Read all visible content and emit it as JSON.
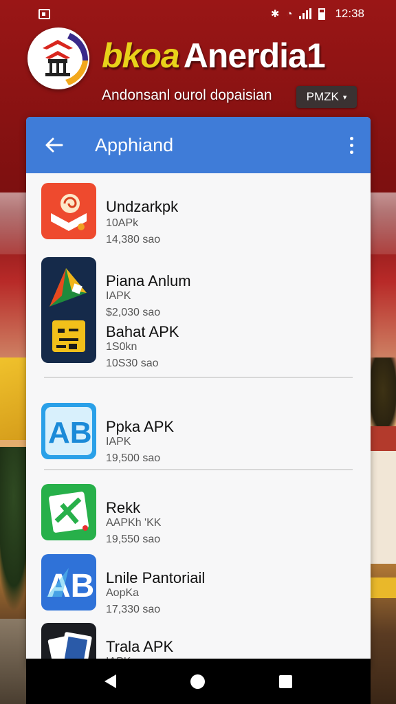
{
  "status_bar": {
    "time": "12:38"
  },
  "banner": {
    "title_part1": "bkoa",
    "title_part2": "Anerdia1",
    "subtitle": "Andonsanl ourol dopaisian",
    "chip_label": "PMZK",
    "chip_caret": "▾"
  },
  "toolbar": {
    "title": "Apphiand"
  },
  "apps": [
    {
      "name": "Undzarkpk",
      "line1": "10APk",
      "line2": "14,380 sao"
    },
    {
      "name": "Piana Anlum",
      "line1": "IAPK",
      "line2": "$2,030 sao"
    },
    {
      "name": "Bahat APK",
      "line1": "1S0kn",
      "line2": "10S30 sao"
    },
    {
      "name": "Ppka APK",
      "line1": "IAPK",
      "line2": "19,500 sao"
    },
    {
      "name": "Rekk",
      "line1": "AAPKh 'KK",
      "line2": "19,550 sao"
    },
    {
      "name": "Lnile Pantoriail",
      "line1": "AopKa",
      "line2": "17,330 sao"
    },
    {
      "name": "Trala APK",
      "line1": "IAPKc",
      "line2": ""
    }
  ],
  "colors": {
    "toolbar": "#3f7cd8",
    "banner_accent": "#e8d21a",
    "background": "#8c1414"
  },
  "icons": {
    "back": "arrow-left-icon",
    "more": "more-vert-icon"
  }
}
